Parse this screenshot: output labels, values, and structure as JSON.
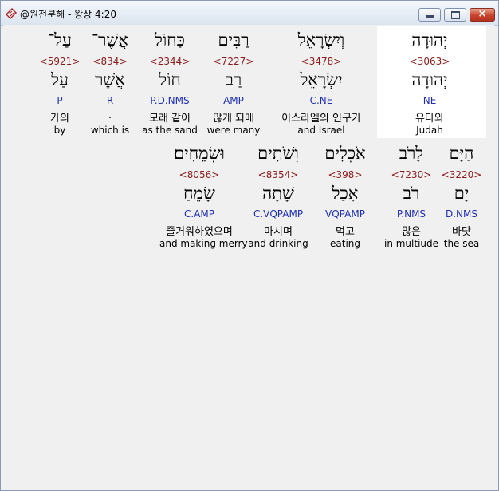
{
  "window": {
    "title": "@원전분해 - 왕상 4:20",
    "controls": {
      "minimize": "minimize-icon",
      "maximize": "maximize-icon",
      "close": "×"
    }
  },
  "verse": {
    "line1": [
      {
        "hebrew": "יְהוּדָה",
        "strongs": "<3063>",
        "lemma": "יְהוּדָה",
        "morph": "NE",
        "korean": "유다와",
        "english": "Judah",
        "selected": true
      },
      {
        "hebrew": "וְיִשְׂרָאֵל",
        "strongs": "<3478>",
        "lemma": "יִשְׂרָאֵל",
        "morph": "C.NE",
        "korean": "이스라엘의 인구가",
        "english": "and Israel"
      },
      {
        "hebrew": "רַבִּים",
        "strongs": "<7227>",
        "lemma": "רַב",
        "morph": "AMP",
        "korean": "많게 되매",
        "english": "were many"
      },
      {
        "hebrew": "כַּחוֹל",
        "strongs": "<2344>",
        "lemma": "חוֹל",
        "morph": "P.D.NMS",
        "korean": "모래 같이",
        "english": "as the sand"
      },
      {
        "hebrew": "אֲשֶׁר־",
        "strongs": "<834>",
        "lemma": "אֲשֶׁר",
        "morph": "R",
        "korean": ".",
        "english": "which is"
      },
      {
        "hebrew": "עַל־",
        "strongs": "<5921>",
        "lemma": "עַל",
        "morph": "P",
        "korean": "가의",
        "english": "by"
      }
    ],
    "line2": [
      {
        "hebrew": "הַיָּם",
        "strongs": "<3220>",
        "lemma": "יָם",
        "morph": "D.NMS",
        "korean": "바닷",
        "english": "the sea"
      },
      {
        "hebrew": "לָרֹב",
        "strongs": "<7230>",
        "lemma": "רֹב",
        "morph": "P.NMS",
        "korean": "많은",
        "english": "in multiude"
      },
      {
        "hebrew": "אֹכְלִים",
        "strongs": "<398>",
        "lemma": "אָכַל",
        "morph": "VQPAMP",
        "korean": "먹고",
        "english": "eating"
      },
      {
        "hebrew": "וְשֹׁתִים",
        "strongs": "<8354>",
        "lemma": "שָׁתָה",
        "morph": "C.VQPAMP",
        "korean": "마시며",
        "english": "and drinking"
      },
      {
        "hebrew": "וּשְׂמֵחִים׃",
        "strongs": "<8056>",
        "lemma": "שָׂמֵחַ",
        "morph": "C.AMP",
        "korean": "즐거워하였으며",
        "english": "and making merry"
      }
    ]
  }
}
